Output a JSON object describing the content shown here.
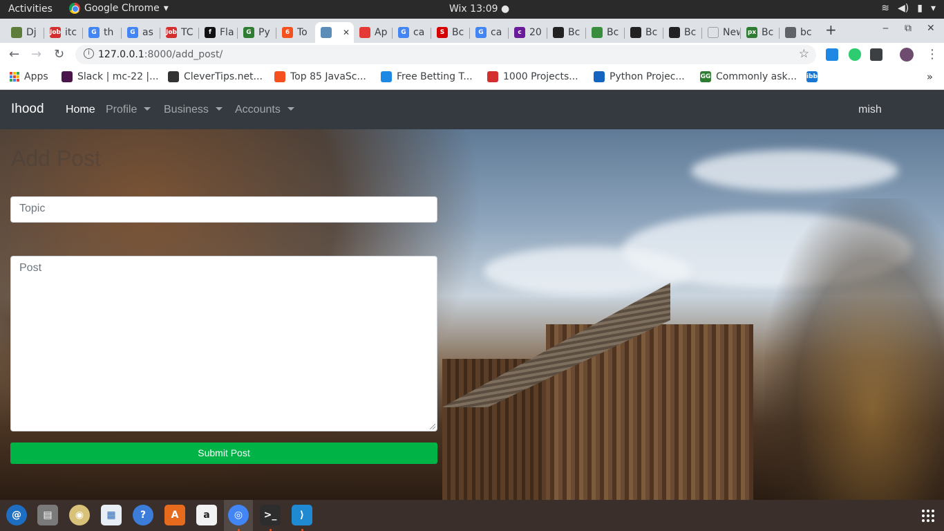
{
  "system": {
    "activities": "Activities",
    "app_menu": "Google Chrome",
    "clock": "Wix 13:09 ●",
    "tray": [
      "wifi-icon",
      "volume-icon",
      "battery-icon",
      "power-menu-icon"
    ]
  },
  "tabs": [
    {
      "label": "Dj",
      "fav": "#5f7d3a"
    },
    {
      "label": "itc",
      "fav": "#d32f2f",
      "favtext": "Job"
    },
    {
      "label": "th",
      "fav": "#4285f4",
      "favtext": "G"
    },
    {
      "label": "as",
      "fav": "#4285f4",
      "favtext": "G"
    },
    {
      "label": "TC",
      "fav": "#d32f2f",
      "favtext": "Job"
    },
    {
      "label": "Fla",
      "fav": "#111111",
      "favtext": "f"
    },
    {
      "label": "Py",
      "fav": "#2e7d32",
      "favtext": "G"
    },
    {
      "label": "To",
      "fav": "#f4511e",
      "favtext": "6"
    },
    {
      "label": "",
      "fav": "#5b8db8",
      "active": true
    },
    {
      "label": "Ap",
      "fav": "#e53935"
    },
    {
      "label": "ca",
      "fav": "#4285f4",
      "favtext": "G"
    },
    {
      "label": "Bc",
      "fav": "#d50000",
      "favtext": "S"
    },
    {
      "label": "ca",
      "fav": "#4285f4",
      "favtext": "G"
    },
    {
      "label": "20",
      "fav": "#6a1b9a",
      "favtext": "c"
    },
    {
      "label": "Bc",
      "fav": "#222222"
    },
    {
      "label": "Bc",
      "fav": "#388e3c"
    },
    {
      "label": "Bc",
      "fav": "#222222"
    },
    {
      "label": "Bc",
      "fav": "#222222"
    },
    {
      "label": "New T",
      "fav": ""
    },
    {
      "label": "Bc",
      "fav": "#2e7d32",
      "favtext": "px"
    },
    {
      "label": "bc",
      "fav": "#5f6368"
    }
  ],
  "window": {
    "new_tab": "+",
    "minimize": "‒",
    "restore": "⧉",
    "close": "✕"
  },
  "toolbar": {
    "url_host": "127.0.0.1",
    "url_rest": ":8000/add_post/"
  },
  "bookmarks": [
    {
      "label": "Apps",
      "fav": "apps"
    },
    {
      "label": "Slack | mc-22 |...",
      "fav": "#4a154b"
    },
    {
      "label": "CleverTips.net...",
      "fav": "#333333"
    },
    {
      "label": "Top 85 JavaSc...",
      "fav": "#f4511e"
    },
    {
      "label": "Free Betting T...",
      "fav": "#1e88e5"
    },
    {
      "label": "1000 Projects...",
      "fav": "#d32f2f"
    },
    {
      "label": "Python Projec...",
      "fav": "#1565c0"
    },
    {
      "label": "Commonly ask...",
      "fav": "#2e7d32",
      "favtext": "GG"
    },
    {
      "label": "",
      "fav": "#1976d2",
      "favtext": "ibb"
    }
  ],
  "site": {
    "brand": "Ihood",
    "nav": [
      {
        "label": "Home",
        "active": true,
        "dropdown": false
      },
      {
        "label": "Profile",
        "active": false,
        "dropdown": true
      },
      {
        "label": "Business",
        "active": false,
        "dropdown": true
      },
      {
        "label": "Accounts",
        "active": false,
        "dropdown": true
      }
    ],
    "user": "mish"
  },
  "form": {
    "title": "Add Post",
    "topic_placeholder": "Topic",
    "post_placeholder": "Post",
    "submit_label": "Submit Post"
  },
  "dock": [
    "thunderbird-icon",
    "files-icon",
    "rhythmbox-icon",
    "libreoffice-writer-icon",
    "help-icon",
    "software-center-icon",
    "amazon-icon",
    "chrome-icon",
    "terminal-icon",
    "vscode-icon"
  ],
  "colors": {
    "navbar": "#343a40",
    "submit": "#00b347",
    "dock": "#3b2f2b"
  }
}
